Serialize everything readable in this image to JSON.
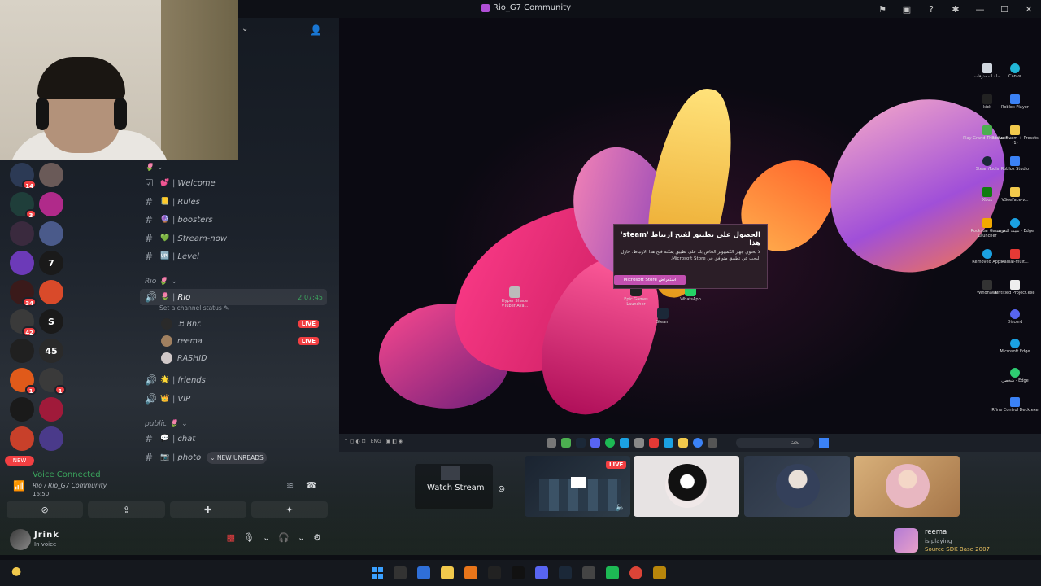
{
  "window": {
    "title": "Rio_G7 Community"
  },
  "channels": {
    "category_top": "🌷",
    "text": [
      {
        "emoji": "💕",
        "name": "Welcome"
      },
      {
        "emoji": "📒",
        "name": "Rules"
      },
      {
        "emoji": "🔮",
        "name": "boosters"
      },
      {
        "emoji": "💚",
        "name": "Stream-now"
      },
      {
        "emoji": "🆙",
        "name": "Level"
      }
    ],
    "category_rio": "Rio 🌷",
    "voice_active": {
      "name": "Rio",
      "duration": "2:07:45",
      "status_hint": "Set a channel status"
    },
    "voice_users": [
      {
        "name": "♬ Bnr.",
        "live": "LIVE"
      },
      {
        "name": "reema",
        "live": "LIVE"
      },
      {
        "name": "RASHID",
        "live": ""
      }
    ],
    "voice_channels": [
      {
        "emoji": "🌟",
        "name": "friends"
      },
      {
        "emoji": "👑",
        "name": "VIP"
      }
    ],
    "category_public": "public 🌷",
    "public_channels": [
      {
        "emoji": "💬",
        "name": "chat"
      },
      {
        "emoji": "📷",
        "name": "photo"
      }
    ],
    "new_unreads": "NEW UNREADS"
  },
  "servers": {
    "badges": [
      "14",
      "3",
      "34",
      "42",
      "1",
      "1"
    ],
    "new_pill": "NEW"
  },
  "voice_panel": {
    "title": "Voice Connected",
    "subtitle": "Rio / Rio_G7 Community",
    "time": "16:50"
  },
  "user_panel": {
    "name": "Jrink",
    "status": "In voice"
  },
  "stream": {
    "popup_title": "الحصول على تطبيق لفتح ارتباط 'steam' هذا",
    "popup_body": "لا يحتوي جهاز الكمبيوتر الخاص بك على تطبيق يمكنه فتح هذا الارتباط. حاول البحث عن تطبيق متوافق في Microsoft Store.",
    "popup_button": "Microsoft Store استعراض",
    "desktop_icons_right": [
      {
        "label": "سلة المحذوفات",
        "color": "#d0d6de"
      },
      {
        "label": "Canva",
        "color": "#21b6d6"
      },
      {
        "label": "kick",
        "color": "#222"
      },
      {
        "label": "Roblox Player",
        "color": "#3b82f6"
      },
      {
        "label": "Play Grand Theft Auto...",
        "color": "#4caf50"
      },
      {
        "label": "Redux Fivem + Presets (1)",
        "color": "#f2c94c"
      },
      {
        "label": "SteamTools",
        "color": "#1b2838"
      },
      {
        "label": "Roblox Studio",
        "color": "#3b82f6"
      },
      {
        "label": "Xbox",
        "color": "#107c10"
      },
      {
        "label": "VSeeFace-v...",
        "color": "#f2c94c"
      },
      {
        "label": "Rockstar Games Launcher",
        "color": "#f2a900"
      },
      {
        "label": "تثبيت التعريف - Edge",
        "color": "#1ba1e2"
      },
      {
        "label": "Removed Apps",
        "color": "#1ba1e2"
      },
      {
        "label": "Radial-mult...",
        "color": "#e53935"
      },
      {
        "label": "Windhawk",
        "color": "#333"
      },
      {
        "label": "Untitled Project.exe",
        "color": "#eee"
      },
      {
        "label": "Discord",
        "color": "#5865f2"
      },
      {
        "label": "Microsoft Edge",
        "color": "#1ba1e2"
      },
      {
        "label": "شخصي - Edge",
        "color": "#2ecc71"
      },
      {
        "label": "Removed Apps",
        "color": "#1ba1e2"
      },
      {
        "label": "Rfine Control Deck.exe",
        "color": "#3b82f6"
      }
    ],
    "desktop_icons_center": [
      {
        "label": "Hyper Shade VTuber Ava...",
        "color": "#bbb"
      },
      {
        "label": "Epic Games Launcher",
        "color": "#222"
      },
      {
        "label": "WhatsApp",
        "color": "#25d366"
      },
      {
        "label": "Steam",
        "color": "#1b2838"
      }
    ],
    "taskbar_lang": "ENG",
    "taskbar_search": "بحث"
  },
  "tiles": {
    "watch_label": "Watch Stream",
    "live_label": "LIVE"
  },
  "toast": {
    "name": "reema",
    "status": "is playing",
    "game": "Source SDK Base 2007"
  }
}
